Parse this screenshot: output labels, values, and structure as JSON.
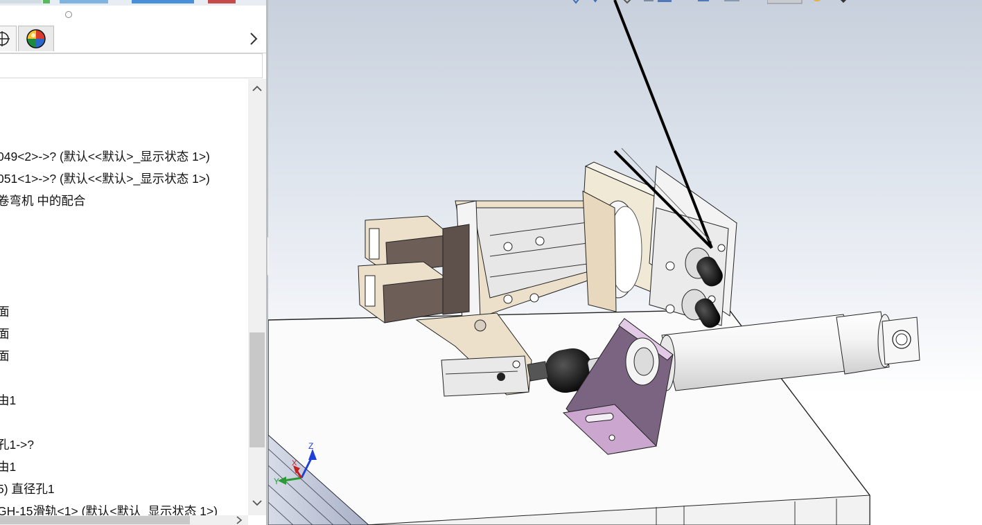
{
  "feature_tree": {
    "rows": [
      {
        "text": "049<2>->? (默认<<默认>_显示状态 1>)"
      },
      {
        "text": "051<1>->? (默认<<默认>_显示状态 1>)"
      },
      {
        "text": "卷弯机 中的配合"
      },
      {
        "text": "面"
      },
      {
        "text": "面"
      },
      {
        "text": "面"
      },
      {
        "text": "由1"
      },
      {
        "text": "孔1->?"
      },
      {
        "text": "由1"
      },
      {
        "text": "5) 直径孔1"
      },
      {
        "text": "GH-15滑轨<1> (默认<默认_显示状态 1>)"
      }
    ]
  },
  "triad": {
    "x_label": "X",
    "y_label": "Y",
    "z_label": "Z"
  },
  "colors": {
    "part_tan": "#eee0cc",
    "part_dark": "#6e5e58",
    "bracket_purple": "#c9a8cf",
    "cylinder_white": "#f2f2f2",
    "table_white": "#fafafa"
  }
}
